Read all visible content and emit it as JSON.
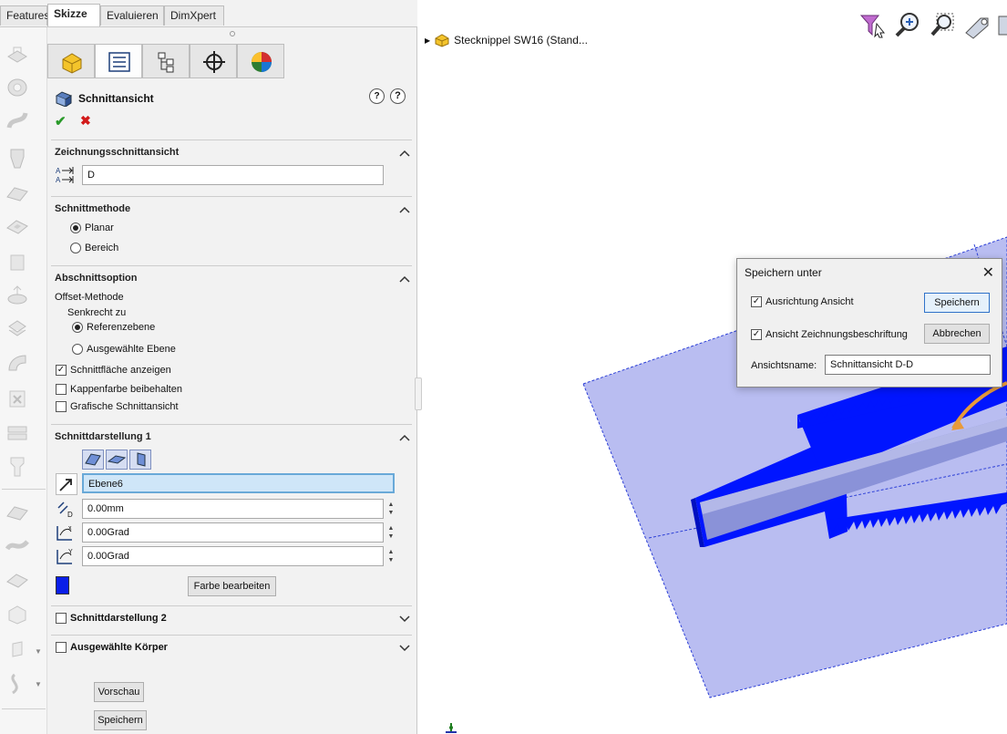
{
  "tabs": [
    "Features",
    "Skizze",
    "Evaluieren",
    "DimXpert"
  ],
  "active_tab": "Skizze",
  "pm": {
    "title": "Schnittansicht",
    "sections": {
      "drawing_section": {
        "title": "Zeichnungsschnittansicht",
        "label_value": "D"
      },
      "method": {
        "title": "Schnittmethode",
        "options": [
          "Planar",
          "Bereich"
        ],
        "selected": "Planar"
      },
      "option": {
        "title": "Abschnittsoption",
        "offset_label": "Offset-Methode",
        "perpendicular_label": "Senkrecht zu",
        "choices": [
          "Referenzebene",
          "Ausgewählte Ebene"
        ],
        "selected": "Referenzebene",
        "checkboxes": [
          {
            "label": "Schnittfläche anzeigen",
            "checked": true
          },
          {
            "label": "Kappenfarbe beibehalten",
            "checked": false
          },
          {
            "label": "Grafische Schnittansicht",
            "checked": false
          }
        ]
      },
      "section1": {
        "title": "Schnittdarstellung 1",
        "plane": "Ebene6",
        "distance": "0.00mm",
        "angle_x": "0.00Grad",
        "angle_y": "0.00Grad",
        "color_button": "Farbe bearbeiten",
        "color": "#0a1ee8"
      },
      "section2": {
        "title": "Schnittdarstellung 2"
      },
      "selected_bodies": {
        "title": "Ausgewählte Körper"
      }
    },
    "preview_button": "Vorschau",
    "save_button": "Speichern"
  },
  "tree": {
    "root_label": "Stecknippel SW16  (Stand..."
  },
  "dialog": {
    "title": "Speichern unter",
    "checkbox_orientation": "Ausrichtung Ansicht",
    "checkbox_annotation": "Ansicht Zeichnungsbeschriftung",
    "save_button": "Speichern",
    "cancel_button": "Abbrechen",
    "name_label": "Ansichtsname:",
    "name_value": "Schnittansicht D-D"
  }
}
